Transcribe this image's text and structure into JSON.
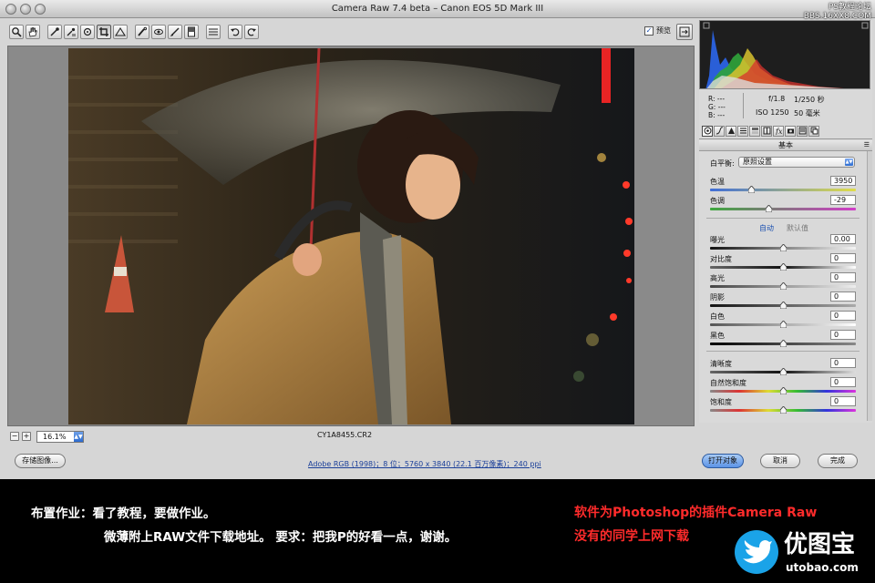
{
  "window": {
    "title": "Camera Raw 7.4 beta –  Canon EOS 5D Mark III",
    "watermark_line1": "PS教程论坛",
    "watermark_line2": "BBS.16XX8.COM"
  },
  "toolbar": {
    "tools": [
      "zoom-icon",
      "hand-icon",
      "white-balance-icon",
      "color-sampler-icon",
      "target-adjust-icon",
      "crop-icon",
      "straighten-icon",
      "spot-removal-icon",
      "red-eye-icon",
      "adjustment-brush-icon",
      "graduated-filter-icon",
      "preferences-icon",
      "rotate-ccw-icon",
      "rotate-cw-icon"
    ],
    "preview_label": "预览",
    "preview_checked": true
  },
  "canvas": {
    "zoom_value": "16.1%",
    "filename": "CY1A8455.CR2"
  },
  "info": {
    "r_label": "R:",
    "r_value": "---",
    "g_label": "G:",
    "g_value": "---",
    "b_label": "B:",
    "b_value": "---",
    "aperture": "f/1.8",
    "shutter": "1/250 秒",
    "iso": "ISO 1250",
    "focal": "50 毫米"
  },
  "panel": {
    "section_title": "基本",
    "white_balance_label": "白平衡:",
    "white_balance_value": "原照设置",
    "auto_label": "自动",
    "default_label": "默认值",
    "sliders": {
      "temperature": {
        "label": "色温",
        "value": "3950",
        "position": 0.28
      },
      "tint": {
        "label": "色调",
        "value": "-29",
        "position": 0.4
      },
      "exposure": {
        "label": "曝光",
        "value": "0.00",
        "position": 0.5
      },
      "contrast": {
        "label": "对比度",
        "value": "0",
        "position": 0.5
      },
      "highlights": {
        "label": "高光",
        "value": "0",
        "position": 0.5
      },
      "shadows": {
        "label": "阴影",
        "value": "0",
        "position": 0.5
      },
      "whites": {
        "label": "白色",
        "value": "0",
        "position": 0.5
      },
      "blacks": {
        "label": "黑色",
        "value": "0",
        "position": 0.5
      },
      "clarity": {
        "label": "清晰度",
        "value": "0",
        "position": 0.5
      },
      "vibrance": {
        "label": "自然饱和度",
        "value": "0",
        "position": 0.5
      },
      "saturation": {
        "label": "饱和度",
        "value": "0",
        "position": 0.5
      }
    }
  },
  "bottom": {
    "save_label": "存储图像...",
    "workflow_link": "Adobe RGB (1998)；8 位；5760 x 3840 (22.1 百万像素)；240 ppi",
    "open_label": "打开对象",
    "cancel_label": "取消",
    "done_label": "完成"
  },
  "footer": {
    "line1": "布置作业：看了教程，要做作业。",
    "line2": "微薄附上RAW文件下载地址。 要求：把我P的好看一点，谢谢。",
    "red1": "软件为Photoshop的插件Camera Raw",
    "red2": "没有的同学上网下载",
    "logo_text": "优图宝",
    "logo_url": "utobao.com"
  },
  "colors": {
    "accent_blue": "#2b6bd0",
    "footer_red": "#ff2b2b",
    "logo_blue": "#1aa3e8"
  }
}
